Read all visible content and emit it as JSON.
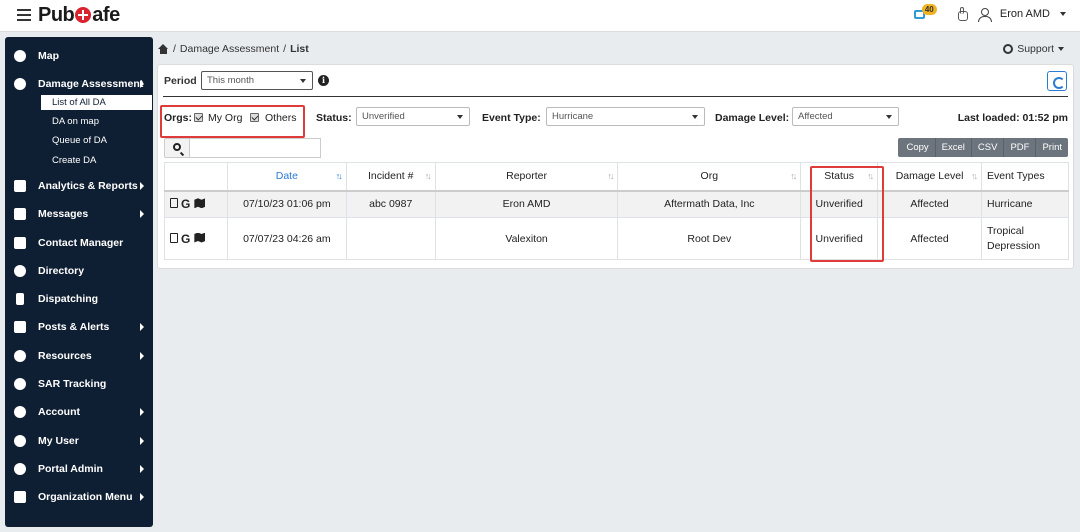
{
  "header": {
    "app_name_left": "Pub",
    "app_name_right": "afe",
    "notification_count": "40",
    "user_name": "Eron AMD"
  },
  "sidebar": {
    "items": [
      {
        "label": "Map",
        "icon": "globe-icon"
      },
      {
        "label": "Damage Assessment",
        "icon": "globe-icon"
      },
      {
        "label": "Analytics & Reports",
        "icon": "chart-icon"
      },
      {
        "label": "Messages",
        "icon": "envelope-icon"
      },
      {
        "label": "Contact Manager",
        "icon": "address-book-icon"
      },
      {
        "label": "Directory",
        "icon": "users-icon"
      },
      {
        "label": "Dispatching",
        "icon": "mobile-icon"
      },
      {
        "label": "Posts & Alerts",
        "icon": "megaphone-icon"
      },
      {
        "label": "Resources",
        "icon": "cubes-icon"
      },
      {
        "label": "SAR Tracking",
        "icon": "route-icon"
      },
      {
        "label": "Account",
        "icon": "gear-icon"
      },
      {
        "label": "My User",
        "icon": "user-icon"
      },
      {
        "label": "Portal Admin",
        "icon": "shield-gear-icon"
      },
      {
        "label": "Organization Menu",
        "icon": "building-icon"
      }
    ],
    "sub_items": [
      {
        "label": "List of All DA"
      },
      {
        "label": "DA on map"
      },
      {
        "label": "Queue of DA"
      },
      {
        "label": "Create DA"
      }
    ]
  },
  "breadcrumb": {
    "section": "Damage Assessment",
    "page": "List",
    "separator": "/"
  },
  "support_label": "Support",
  "filters": {
    "period_label": "Period",
    "period_value": "This month",
    "orgs_label": "Orgs:",
    "my_org_label": "My Org",
    "others_label": "Others",
    "status_label": "Status:",
    "status_value": "Unverified",
    "event_type_label": "Event Type:",
    "event_type_value": "Hurricane",
    "damage_level_label": "Damage Level:",
    "damage_level_value": "Affected",
    "last_loaded": "Last loaded: 01:52 pm"
  },
  "export_buttons": [
    "Copy",
    "Excel",
    "CSV",
    "PDF",
    "Print"
  ],
  "table": {
    "columns": [
      "",
      "Date",
      "Incident #",
      "Reporter",
      "Org",
      "Status",
      "Damage Level",
      "Event Types"
    ],
    "rows": [
      {
        "date": "07/10/23 01:06 pm",
        "incident": "abc 0987",
        "reporter": "Eron AMD",
        "org": "Aftermath Data, Inc",
        "status": "Unverified",
        "damage_level": "Affected",
        "event_types": "Hurricane"
      },
      {
        "date": "07/07/23 04:26 am",
        "incident": "",
        "reporter": "Valexiton",
        "org": "Root Dev",
        "status": "Unverified",
        "damage_level": "Affected",
        "event_types": "Tropical Depression"
      }
    ]
  },
  "colors": {
    "sidebar_bg": "#0f1f33",
    "accent": "#2a7bd4",
    "highlight": "#e03b3b",
    "brand_red": "#d9232e"
  }
}
